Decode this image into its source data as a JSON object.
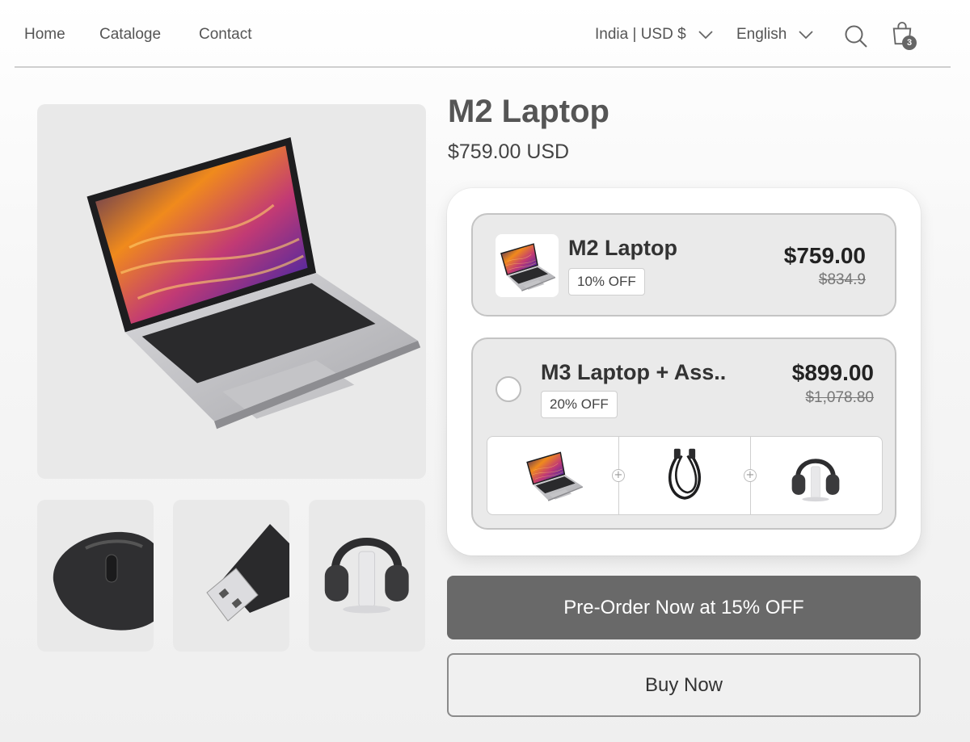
{
  "nav": {
    "links": [
      "Home",
      "Cataloge",
      "Contact"
    ],
    "region": "India | USD $",
    "language": "English",
    "cart_count": "3",
    "icons": {
      "search": "search-icon",
      "cart": "shopping-bag-icon",
      "chevron": "chevron-down-icon"
    }
  },
  "product": {
    "title": "M2 Laptop",
    "price": "$759.00 USD",
    "gallery": [
      "laptop",
      "mouse",
      "usb-drive",
      "headphones"
    ]
  },
  "options": [
    {
      "name": "M2 Laptop",
      "discount": "10% OFF",
      "price": "$759.00",
      "old_price": "$834.9",
      "selected": true
    },
    {
      "name": "M3 Laptop + Ass..",
      "discount": "20% OFF",
      "price": "$899.00",
      "old_price": "$1,078.80",
      "selected": false,
      "bundle_items": [
        "laptop",
        "usb-cable",
        "headphones"
      ],
      "bundle_plus": "+"
    }
  ],
  "actions": {
    "preorder": "Pre-Order Now at 15% OFF",
    "buy": "Buy Now"
  },
  "colors": {
    "primary_button": "#696969",
    "tile_bg": "#e9e9e9",
    "option_bg": "#eaeaea"
  }
}
